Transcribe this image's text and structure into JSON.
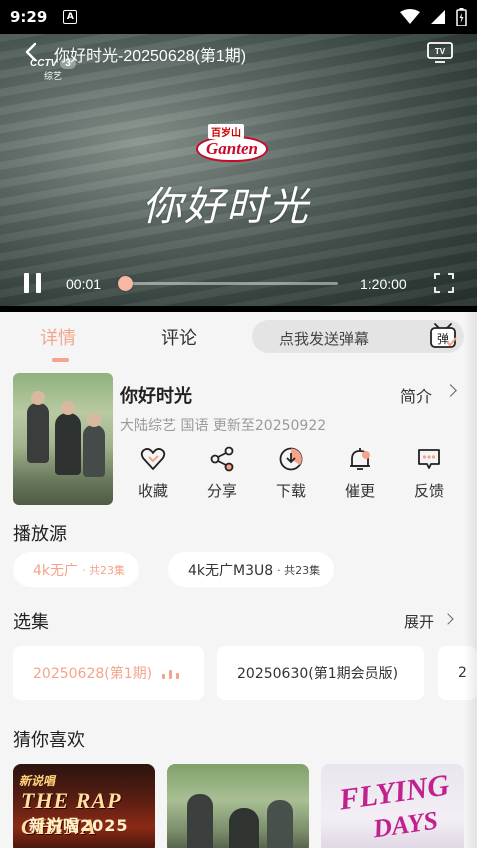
{
  "status_bar": {
    "time": "9:29",
    "notification_icon": "A"
  },
  "player": {
    "title": "你好时光-20250628(第1期)",
    "channel_logo": "CCTV",
    "channel_number": "3",
    "channel_name": "综艺",
    "sponsor_top": "百岁山",
    "sponsor_brand": "Ganten",
    "show_calligraphy": "你好时光",
    "current_time": "00:01",
    "duration": "1:20:00",
    "progress": 0.0
  },
  "tabs": {
    "details": "详情",
    "comments": "评论"
  },
  "danmu": {
    "placeholder": "点我发送弹幕",
    "button": "弹"
  },
  "show": {
    "name": "你好时光",
    "intro_label": "简介",
    "meta": "大陆综艺 国语 更新至20250922"
  },
  "actions": [
    {
      "label": "收藏",
      "icon": "heart-icon"
    },
    {
      "label": "分享",
      "icon": "share-icon"
    },
    {
      "label": "下载",
      "icon": "download-icon"
    },
    {
      "label": "催更",
      "icon": "bell-icon"
    },
    {
      "label": "反馈",
      "icon": "feedback-icon"
    }
  ],
  "sources": {
    "title": "播放源",
    "items": [
      {
        "name": "4k无广",
        "count": "· 共23集"
      },
      {
        "name": "4k无广M3U8",
        "count": "· 共23集"
      }
    ]
  },
  "episodes": {
    "title": "选集",
    "expand": "展开",
    "items": [
      {
        "label": "20250628(第1期)"
      },
      {
        "label": "20250630(第1期会员版)"
      },
      {
        "label": "2"
      }
    ]
  },
  "recommend": {
    "title": "猜你喜欢",
    "items": [
      {
        "badge": "新说唱",
        "line1": "THE RAP CHINA",
        "line2": "新说唱2025"
      },
      {
        "line1": ""
      },
      {
        "line1": "FLYING",
        "line2": "DAYS"
      }
    ]
  },
  "colors": {
    "accent": "#f4a48b",
    "background": "#f5f5f5"
  }
}
